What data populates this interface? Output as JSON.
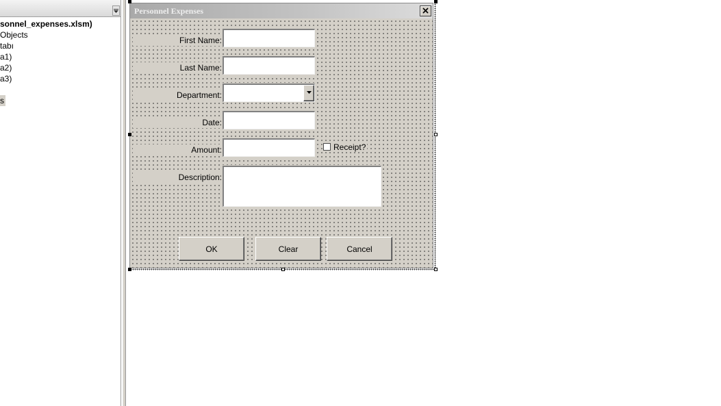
{
  "explorer": {
    "items": [
      {
        "label": "sonnel_expenses.xlsm)",
        "bold": true
      },
      {
        "label": "Objects"
      },
      {
        "label": "tabı"
      },
      {
        "label": "a1)"
      },
      {
        "label": "a2)"
      },
      {
        "label": "a3)"
      },
      {
        "label": ""
      },
      {
        "label": "s",
        "selected": true
      }
    ]
  },
  "form": {
    "title": "Personnel Expenses",
    "close_icon": "close-x-icon",
    "fields": {
      "first_name_label": "First Name:",
      "first_name_value": "",
      "last_name_label": "Last Name:",
      "last_name_value": "",
      "department_label": "Department:",
      "department_value": "",
      "date_label": "Date:",
      "date_value": "",
      "amount_label": "Amount:",
      "amount_value": "",
      "receipt_label": "Receipt?",
      "receipt_checked": false,
      "description_label": "Description:",
      "description_value": ""
    },
    "buttons": {
      "ok": "OK",
      "clear": "Clear",
      "cancel": "Cancel"
    }
  },
  "colors": {
    "form_face": "#d4d0c8",
    "title_bar": "#a9a9a9",
    "title_text": "#eeeeee"
  }
}
